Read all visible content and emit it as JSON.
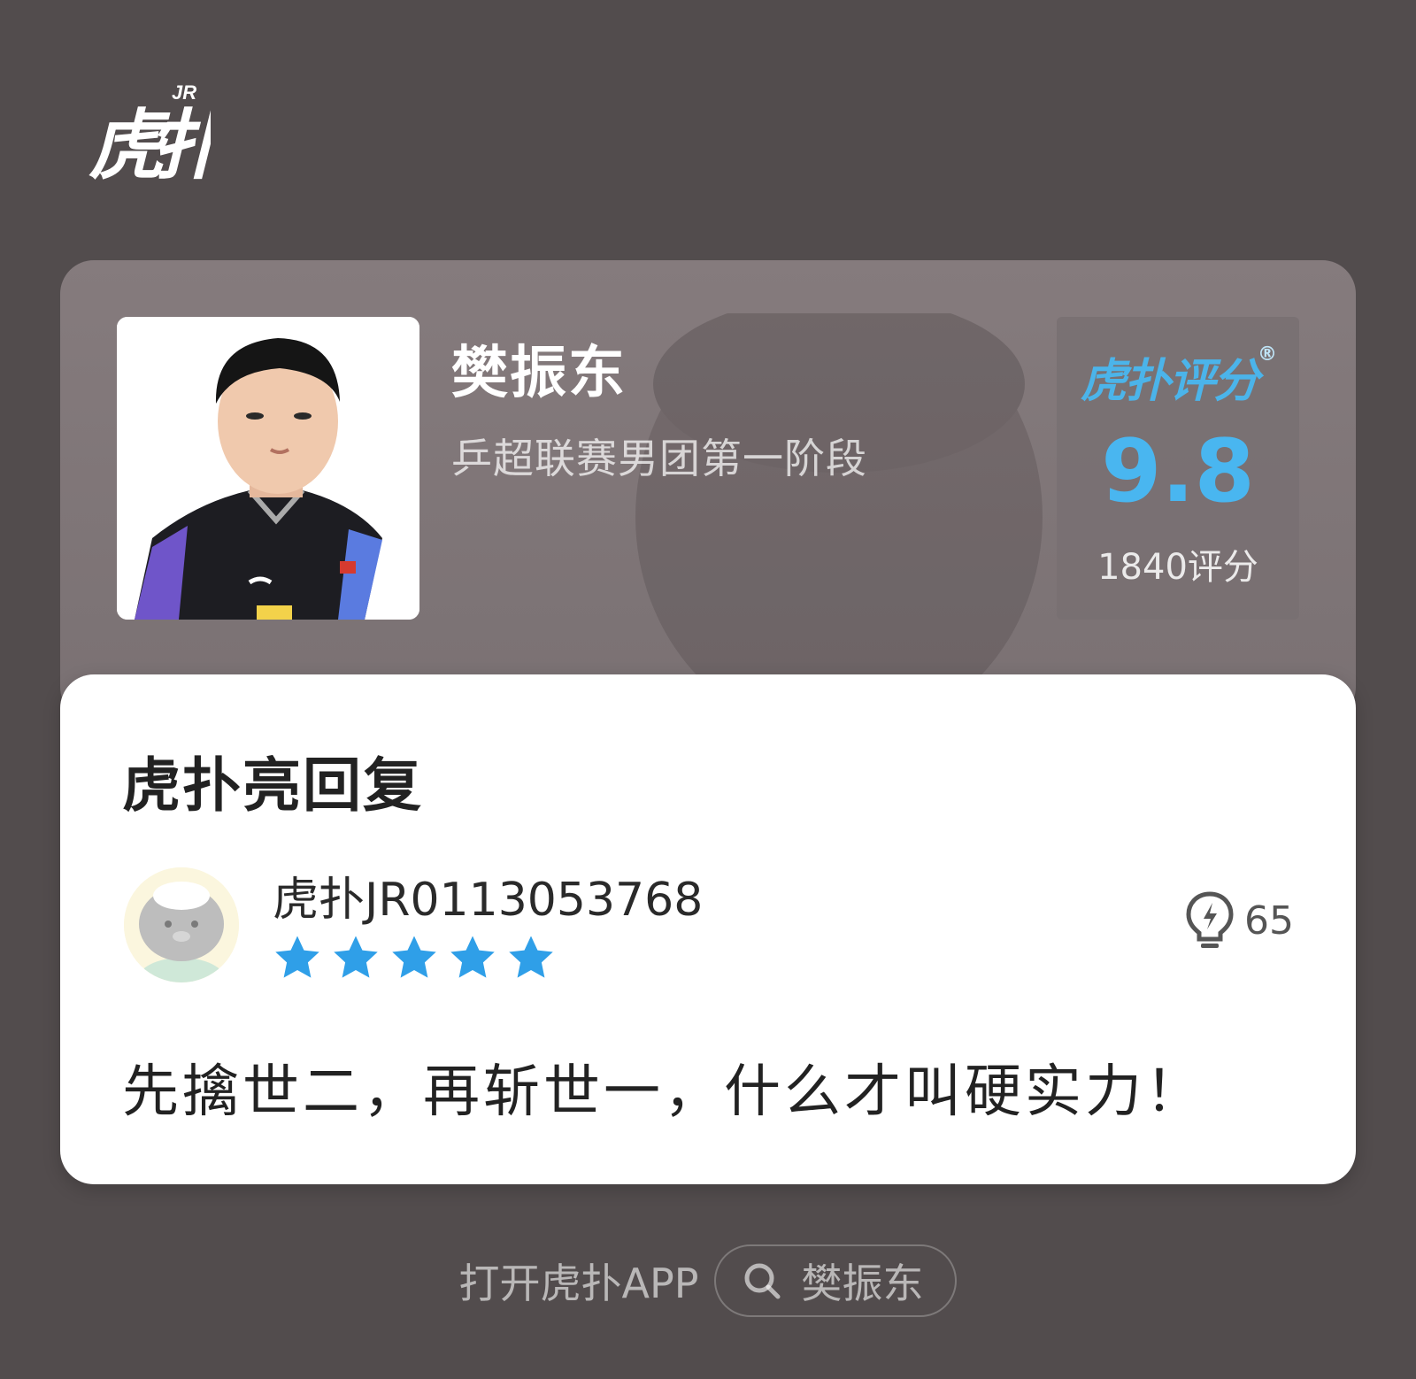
{
  "app": {
    "logo_text": "虎扑",
    "logo_badge": "JR"
  },
  "player": {
    "name": "樊振东",
    "event": "乒超联赛男团第一阶段"
  },
  "rating": {
    "brand": "虎扑评分",
    "registered_mark": "®",
    "score": "9.8",
    "count": "1840评分"
  },
  "reply": {
    "section_title": "虎扑亮回复",
    "username": "虎扑JR0113053768",
    "stars": 5,
    "likes": "65",
    "text": "先擒世二，再斩世一，什么才叫硬实力！"
  },
  "footer": {
    "open_app_label": "打开虎扑APP",
    "search_term": "樊振东"
  },
  "colors": {
    "background": "#524c4d",
    "accent_blue": "#49b6f0",
    "star_blue": "#2f9fe8"
  }
}
